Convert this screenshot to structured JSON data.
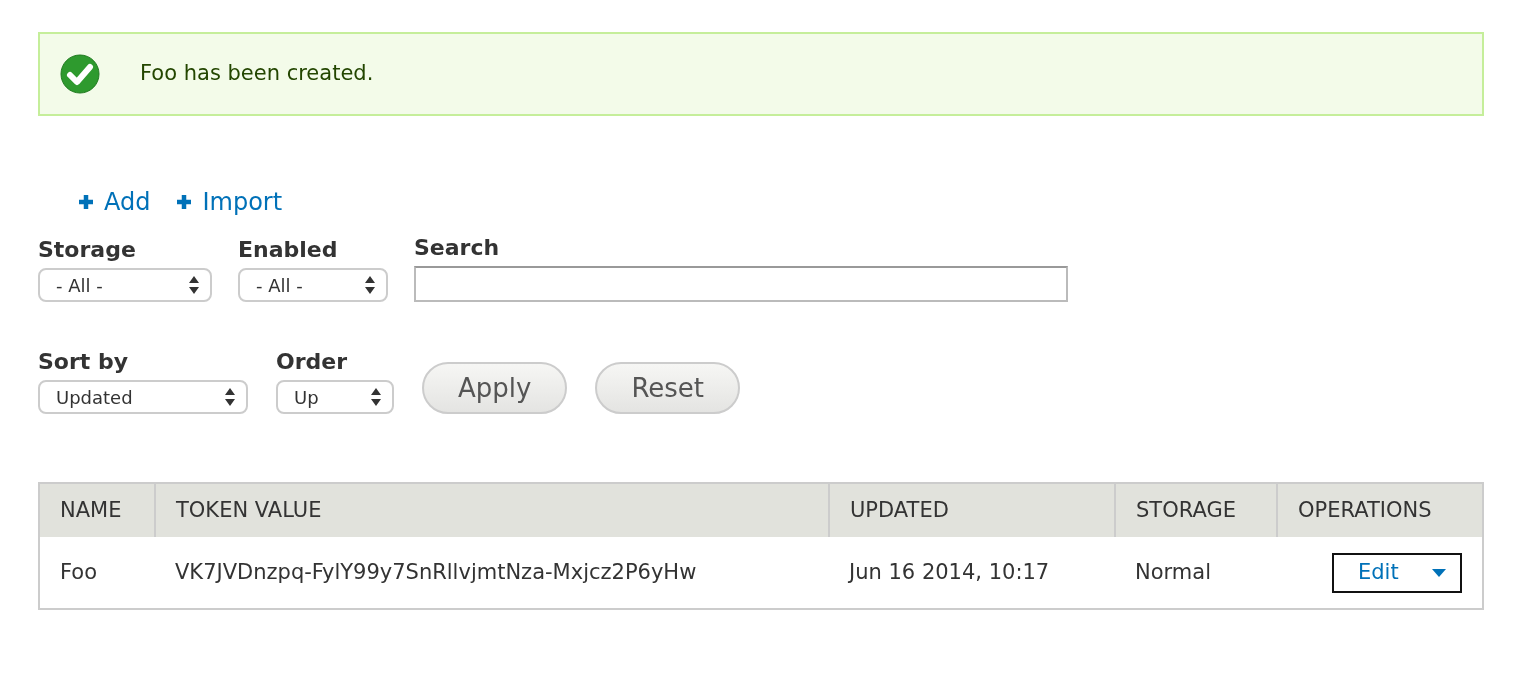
{
  "message": {
    "kind": "status",
    "text": "Foo has been created."
  },
  "actions": [
    {
      "label": "Add"
    },
    {
      "label": "Import"
    }
  ],
  "filters": [
    {
      "label": "Storage",
      "kind": "select",
      "value": "- All -"
    },
    {
      "label": "Enabled",
      "kind": "select",
      "value": "- All -"
    },
    {
      "label": "Search",
      "kind": "text"
    }
  ],
  "sort": [
    {
      "label": "Sort by",
      "kind": "select",
      "value": "Updated"
    },
    {
      "label": "Order",
      "kind": "select",
      "value": "Up"
    }
  ],
  "buttons": [
    "Apply",
    "Reset"
  ],
  "table": {
    "columns": [
      "NAME",
      "TOKEN VALUE",
      "UPDATED",
      "STORAGE",
      "OPERATIONS"
    ],
    "rows": [
      {
        "cells": [
          "Foo",
          "VK7JVDnzpq-FylY99y7SnRllvjmtNza-Mxjcz2P6yHw",
          "Jun 16 2014, 10:17",
          "Normal"
        ],
        "operation": "Edit"
      }
    ]
  }
}
